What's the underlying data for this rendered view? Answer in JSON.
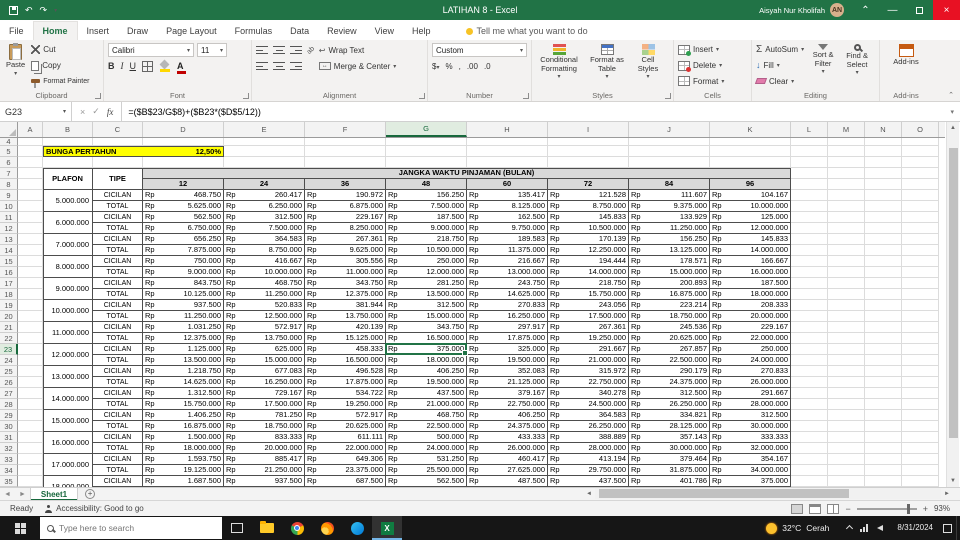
{
  "colors": {
    "accent_green": "#217346",
    "highlight_yellow": "#FFFF00",
    "header_gray": "#D9D9D9",
    "close_red": "#E81123"
  },
  "titlebar": {
    "title": "LATIHAN 8 - Excel",
    "user_name": "Aisyah Nur Kholifah",
    "user_initials": "AN"
  },
  "ribbon": {
    "tabs": [
      {
        "label": "File"
      },
      {
        "label": "Home",
        "active": true
      },
      {
        "label": "Insert"
      },
      {
        "label": "Draw"
      },
      {
        "label": "Page Layout"
      },
      {
        "label": "Formulas"
      },
      {
        "label": "Data"
      },
      {
        "label": "Review"
      },
      {
        "label": "View"
      },
      {
        "label": "Help"
      }
    ],
    "tellme": "Tell me what you want to do",
    "clipboard": {
      "label": "Clipboard",
      "paste": "Paste",
      "cut": "Cut",
      "copy": "Copy",
      "format_painter": "Format Painter"
    },
    "font": {
      "label": "Font",
      "font_name": "Calibri",
      "font_size": "11",
      "bold": "B",
      "italic": "I",
      "underline": "U"
    },
    "alignment": {
      "label": "Alignment",
      "wrap_text": "Wrap Text",
      "merge_center": "Merge & Center"
    },
    "number": {
      "label": "Number",
      "format": "Custom",
      "accounting": "$",
      "percent": "%",
      "comma": ",",
      "inc_decimal": ".00",
      "dec_decimal": ".0"
    },
    "styles": {
      "label": "Styles",
      "conditional": "Conditional Formatting",
      "format_table": "Format as Table",
      "cell_styles": "Cell Styles"
    },
    "cells": {
      "label": "Cells",
      "insert": "Insert",
      "delete": "Delete",
      "format": "Format"
    },
    "editing": {
      "label": "Editing",
      "autosum": "AutoSum",
      "fill": "Fill",
      "clear": "Clear",
      "sort_filter": "Sort & Filter",
      "find_select": "Find & Select"
    },
    "addins": {
      "label": "Add-ins",
      "button": "Add-ins"
    }
  },
  "formula_bar": {
    "name_box": "G23",
    "formula": "=($B$23/G$8)+($B23*($D$5/12))"
  },
  "grid": {
    "columns": [
      "A",
      "B",
      "C",
      "D",
      "E",
      "F",
      "G",
      "H",
      "I",
      "J",
      "K",
      "L",
      "M",
      "N",
      "O"
    ],
    "selected_column": "G",
    "selected_row": 23,
    "first_row": 4,
    "last_row": 35
  },
  "sheet": {
    "bunga_label": "BUNGA PERTAHUN",
    "bunga_value": "12,50%",
    "table": {
      "plafon_header": "PLAFON",
      "tipe_header": "TIPE",
      "months_header": "JANGKA WAKTU PINJAMAN (BULAN)",
      "months": [
        "12",
        "24",
        "36",
        "48",
        "60",
        "72",
        "84",
        "96"
      ],
      "currency": "Rp",
      "row_labels": {
        "cicilan": "CICILAN",
        "total": "TOTAL"
      },
      "rows": [
        {
          "plafon": "5.000.000",
          "cicilan": [
            "468.750",
            "260.417",
            "190.972",
            "156.250",
            "135.417",
            "121.528",
            "111.607",
            "104.167"
          ],
          "total": [
            "5.625.000",
            "6.250.000",
            "6.875.000",
            "7.500.000",
            "8.125.000",
            "8.750.000",
            "9.375.000",
            "10.000.000"
          ]
        },
        {
          "plafon": "6.000.000",
          "cicilan": [
            "562.500",
            "312.500",
            "229.167",
            "187.500",
            "162.500",
            "145.833",
            "133.929",
            "125.000"
          ],
          "total": [
            "6.750.000",
            "7.500.000",
            "8.250.000",
            "9.000.000",
            "9.750.000",
            "10.500.000",
            "11.250.000",
            "12.000.000"
          ]
        },
        {
          "plafon": "7.000.000",
          "cicilan": [
            "656.250",
            "364.583",
            "267.361",
            "218.750",
            "189.583",
            "170.139",
            "156.250",
            "145.833"
          ],
          "total": [
            "7.875.000",
            "8.750.000",
            "9.625.000",
            "10.500.000",
            "11.375.000",
            "12.250.000",
            "13.125.000",
            "14.000.000"
          ]
        },
        {
          "plafon": "8.000.000",
          "cicilan": [
            "750.000",
            "416.667",
            "305.556",
            "250.000",
            "216.667",
            "194.444",
            "178.571",
            "166.667"
          ],
          "total": [
            "9.000.000",
            "10.000.000",
            "11.000.000",
            "12.000.000",
            "13.000.000",
            "14.000.000",
            "15.000.000",
            "16.000.000"
          ]
        },
        {
          "plafon": "9.000.000",
          "cicilan": [
            "843.750",
            "468.750",
            "343.750",
            "281.250",
            "243.750",
            "218.750",
            "200.893",
            "187.500"
          ],
          "total": [
            "10.125.000",
            "11.250.000",
            "12.375.000",
            "13.500.000",
            "14.625.000",
            "15.750.000",
            "16.875.000",
            "18.000.000"
          ]
        },
        {
          "plafon": "10.000.000",
          "cicilan": [
            "937.500",
            "520.833",
            "381.944",
            "312.500",
            "270.833",
            "243.056",
            "223.214",
            "208.333"
          ],
          "total": [
            "11.250.000",
            "12.500.000",
            "13.750.000",
            "15.000.000",
            "16.250.000",
            "17.500.000",
            "18.750.000",
            "20.000.000"
          ]
        },
        {
          "plafon": "11.000.000",
          "cicilan": [
            "1.031.250",
            "572.917",
            "420.139",
            "343.750",
            "297.917",
            "267.361",
            "245.536",
            "229.167"
          ],
          "total": [
            "12.375.000",
            "13.750.000",
            "15.125.000",
            "16.500.000",
            "17.875.000",
            "19.250.000",
            "20.625.000",
            "22.000.000"
          ]
        },
        {
          "plafon": "12.000.000",
          "cicilan": [
            "1.125.000",
            "625.000",
            "458.333",
            "375.000",
            "325.000",
            "291.667",
            "267.857",
            "250.000"
          ],
          "total": [
            "13.500.000",
            "15.000.000",
            "16.500.000",
            "18.000.000",
            "19.500.000",
            "21.000.000",
            "22.500.000",
            "24.000.000"
          ]
        },
        {
          "plafon": "13.000.000",
          "cicilan": [
            "1.218.750",
            "677.083",
            "496.528",
            "406.250",
            "352.083",
            "315.972",
            "290.179",
            "270.833"
          ],
          "total": [
            "14.625.000",
            "16.250.000",
            "17.875.000",
            "19.500.000",
            "21.125.000",
            "22.750.000",
            "24.375.000",
            "26.000.000"
          ]
        },
        {
          "plafon": "14.000.000",
          "cicilan": [
            "1.312.500",
            "729.167",
            "534.722",
            "437.500",
            "379.167",
            "340.278",
            "312.500",
            "291.667"
          ],
          "total": [
            "15.750.000",
            "17.500.000",
            "19.250.000",
            "21.000.000",
            "22.750.000",
            "24.500.000",
            "26.250.000",
            "28.000.000"
          ]
        },
        {
          "plafon": "15.000.000",
          "cicilan": [
            "1.406.250",
            "781.250",
            "572.917",
            "468.750",
            "406.250",
            "364.583",
            "334.821",
            "312.500"
          ],
          "total": [
            "16.875.000",
            "18.750.000",
            "20.625.000",
            "22.500.000",
            "24.375.000",
            "26.250.000",
            "28.125.000",
            "30.000.000"
          ]
        },
        {
          "plafon": "16.000.000",
          "cicilan": [
            "1.500.000",
            "833.333",
            "611.111",
            "500.000",
            "433.333",
            "388.889",
            "357.143",
            "333.333"
          ],
          "total": [
            "18.000.000",
            "20.000.000",
            "22.000.000",
            "24.000.000",
            "26.000.000",
            "28.000.000",
            "30.000.000",
            "32.000.000"
          ]
        },
        {
          "plafon": "17.000.000",
          "cicilan": [
            "1.593.750",
            "885.417",
            "649.306",
            "531.250",
            "460.417",
            "413.194",
            "379.464",
            "354.167"
          ],
          "total": [
            "19.125.000",
            "21.250.000",
            "23.375.000",
            "25.500.000",
            "27.625.000",
            "29.750.000",
            "31.875.000",
            "34.000.000"
          ]
        },
        {
          "plafon": "18.000.000",
          "cicilan": [
            "1.687.500",
            "937.500",
            "687.500",
            "562.500",
            "487.500",
            "437.500",
            "401.786",
            "375.000"
          ]
        }
      ]
    }
  },
  "sheet_tabs": {
    "active": "Sheet1"
  },
  "status_bar": {
    "ready": "Ready",
    "accessibility": "Accessibility: Good to go",
    "zoom": "93%"
  },
  "taskbar": {
    "search_placeholder": "Type here to search",
    "weather_temp": "32°C",
    "weather_desc": "Cerah",
    "date": "8/31/2024"
  }
}
